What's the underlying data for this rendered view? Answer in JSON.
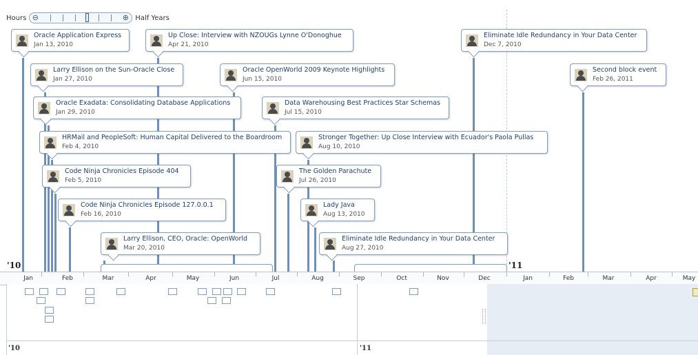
{
  "zoom": {
    "min_label": "Hours",
    "max_label": "Half Years"
  },
  "years": {
    "y2010": "'10",
    "y2011": "'11"
  },
  "months": [
    "Jan",
    "Feb",
    "Mar",
    "Apr",
    "May",
    "Jun",
    "Jul",
    "Aug",
    "Sep",
    "Oct",
    "Nov",
    "Dec",
    "Jan",
    "Feb",
    "Mar",
    "Apr",
    "May"
  ],
  "events": [
    {
      "title": "Oracle Application Express",
      "date": "Jan 13, 2010"
    },
    {
      "title": "Up Close: Interview with NZOUGs Lynne O'Donoghue",
      "date": "Apr 21, 2010"
    },
    {
      "title": "Eliminate Idle Redundancy in Your Data Center",
      "date": "Dec 7, 2010"
    },
    {
      "title": "Larry Ellison on the Sun-Oracle Close",
      "date": "Jan 27, 2010"
    },
    {
      "title": "Oracle OpenWorld 2009 Keynote Highlights",
      "date": "Jun 15, 2010"
    },
    {
      "title": "Second block event",
      "date": "Feb 26, 2011"
    },
    {
      "title": "Oracle Exadata: Consolidating Database Applications",
      "date": "Jan 29, 2010"
    },
    {
      "title": "Data Warehousing Best Practices Star Schemas",
      "date": "Jul 15, 2010"
    },
    {
      "title": "HRMail and PeopleSoft: Human Capital Delivered to the Boardroom",
      "date": "Feb 4, 2010"
    },
    {
      "title": "Stronger Together: Up Close Interview with Ecuador's Paola Pullas",
      "date": "Aug 10, 2010"
    },
    {
      "title": "Code Ninja Chronicles Episode 404",
      "date": "Feb 5, 2010"
    },
    {
      "title": "The Golden Parachute",
      "date": "Jul 26, 2010"
    },
    {
      "title": "Code Ninja Chronicles Episode 127.0.0.1",
      "date": "Feb 16, 2010"
    },
    {
      "title": "Lady Java",
      "date": "Aug 13, 2010"
    },
    {
      "title": "Larry Ellison, CEO, Oracle: OpenWorld",
      "date": "Mar 20, 2010"
    },
    {
      "title": "Eliminate Idle Redundancy in Your Data Center",
      "date": "Aug 27, 2010"
    }
  ],
  "overview": {
    "y2010": "'10",
    "y2011": "'11"
  }
}
